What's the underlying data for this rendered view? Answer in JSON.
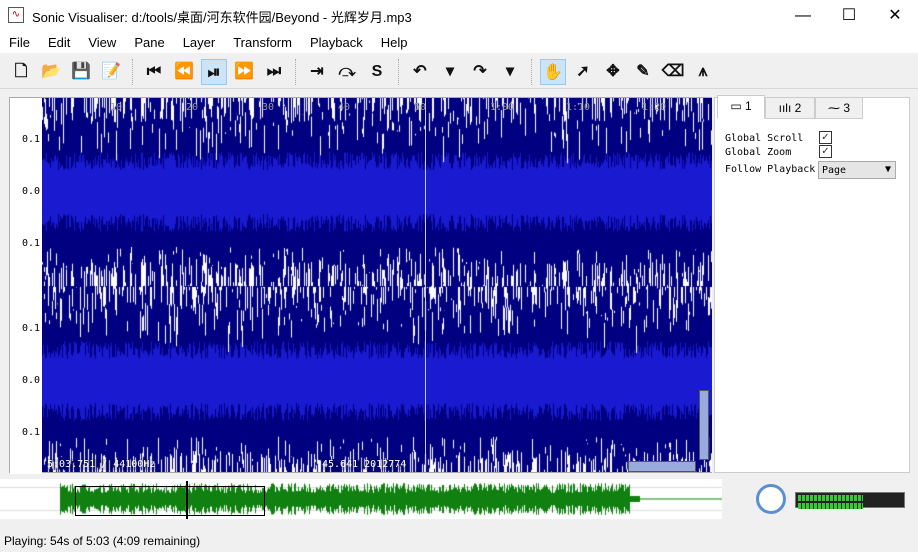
{
  "window": {
    "title": "Sonic Visualiser: d:/tools/桌面/河东软件园/Beyond - 光辉岁月.mp3",
    "minimize": "—",
    "maximize": "☐",
    "close": "✕"
  },
  "menu": [
    "File",
    "Edit",
    "View",
    "Pane",
    "Layer",
    "Transform",
    "Playback",
    "Help"
  ],
  "toolbar": {
    "groups": [
      [
        {
          "icon": "new-file-icon",
          "glyph": "🗋"
        },
        {
          "icon": "open-folder-icon",
          "glyph": "📂"
        },
        {
          "icon": "save-icon",
          "glyph": "💾"
        },
        {
          "icon": "save-as-icon",
          "glyph": "📝"
        }
      ],
      [
        {
          "icon": "rewind-start-icon",
          "glyph": "⏮"
        },
        {
          "icon": "rewind-icon",
          "glyph": "⏪"
        },
        {
          "icon": "play-pause-icon",
          "glyph": "⏯",
          "active": true
        },
        {
          "icon": "fast-forward-icon",
          "glyph": "⏩"
        },
        {
          "icon": "ffwd-end-icon",
          "glyph": "⏭"
        }
      ],
      [
        {
          "icon": "constrain-play-icon",
          "glyph": "⇥"
        },
        {
          "icon": "loop-icon",
          "glyph": "⤼"
        },
        {
          "icon": "solo-icon",
          "glyph": "S"
        }
      ],
      [
        {
          "icon": "undo-icon",
          "glyph": "↶"
        },
        {
          "icon": "undo-menu-icon",
          "glyph": "▾"
        },
        {
          "icon": "redo-icon",
          "glyph": "↷"
        },
        {
          "icon": "redo-menu-icon",
          "glyph": "▾"
        }
      ],
      [
        {
          "icon": "navigate-hand-icon",
          "glyph": "✋",
          "active": true
        },
        {
          "icon": "select-arrow-icon",
          "glyph": "➚"
        },
        {
          "icon": "move-icon",
          "glyph": "✥"
        },
        {
          "icon": "draw-pencil-icon",
          "glyph": "✎"
        },
        {
          "icon": "erase-icon",
          "glyph": "⌫"
        },
        {
          "icon": "measure-icon",
          "glyph": "⩚"
        }
      ]
    ]
  },
  "scale": {
    "ticks_top": [
      "0.1",
      "0.0",
      "0.1"
    ],
    "ticks_bottom": [
      "0.1",
      "0.0",
      "0.1"
    ]
  },
  "ruler": [
    "10",
    "20",
    "30",
    "40",
    "50",
    "1:00",
    "1:10",
    "1:20",
    "1:30"
  ],
  "pane": {
    "duration_label": "5:03.751 / 44100Hz",
    "cursor_label": "45.641 2012774"
  },
  "properties": {
    "tabs": [
      "1",
      "2",
      "3"
    ],
    "global_scroll": "Global Scroll",
    "global_zoom": "Global Zoom",
    "follow_playback": "Follow Playback",
    "follow_value": "Page",
    "global_scroll_checked": true,
    "global_zoom_checked": true
  },
  "colors": {
    "wave_dark": "#000080",
    "wave_mid": "#1a1ad0",
    "overview": "#108010"
  },
  "status": "Playing: 54s of 5:03 (4:09 remaining)",
  "playback_progress": 0.178
}
